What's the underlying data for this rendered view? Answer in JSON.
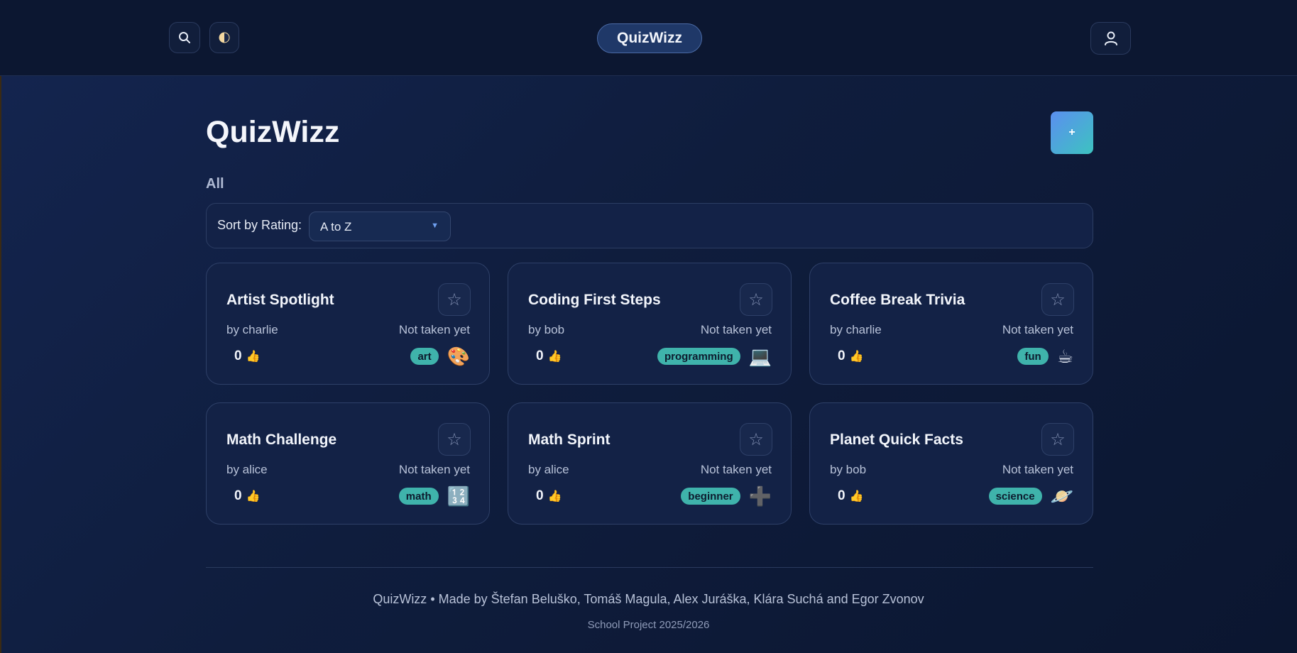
{
  "header": {
    "brand": "QuizWizz",
    "search_icon": "search-icon",
    "theme_icon": "half-moon-icon",
    "user_icon": "user-icon"
  },
  "main": {
    "title": "QuizWizz",
    "add_label": "+",
    "filter_label": "All",
    "sort": {
      "label": "Sort by Rating:",
      "value": "A to Z"
    }
  },
  "quizzes": [
    {
      "title": "Artist Spotlight",
      "author": "by charlie",
      "status": "Not taken yet",
      "rating": "0",
      "tag": "art",
      "emoji": "🎨"
    },
    {
      "title": "Coding First Steps",
      "author": "by bob",
      "status": "Not taken yet",
      "rating": "0",
      "tag": "programming",
      "emoji": "💻"
    },
    {
      "title": "Coffee Break Trivia",
      "author": "by charlie",
      "status": "Not taken yet",
      "rating": "0",
      "tag": "fun",
      "emoji": "☕"
    },
    {
      "title": "Math Challenge",
      "author": "by alice",
      "status": "Not taken yet",
      "rating": "0",
      "tag": "math",
      "emoji": "🔢"
    },
    {
      "title": "Math Sprint",
      "author": "by alice",
      "status": "Not taken yet",
      "rating": "0",
      "tag": "beginner",
      "emoji": "➕"
    },
    {
      "title": "Planet Quick Facts",
      "author": "by bob",
      "status": "Not taken yet",
      "rating": "0",
      "tag": "science",
      "emoji": "🪐"
    }
  ],
  "footer": {
    "credits": "QuizWizz • Made by Štefan Beluško, Tomáš Magula, Alex Juráška, Klára Suchá and Egor Zvonov",
    "subtitle": "School Project 2025/2026"
  },
  "colors": {
    "accent": "#5b8ff0",
    "tag": "#3fb3ab",
    "background": "#0f1d3d"
  }
}
